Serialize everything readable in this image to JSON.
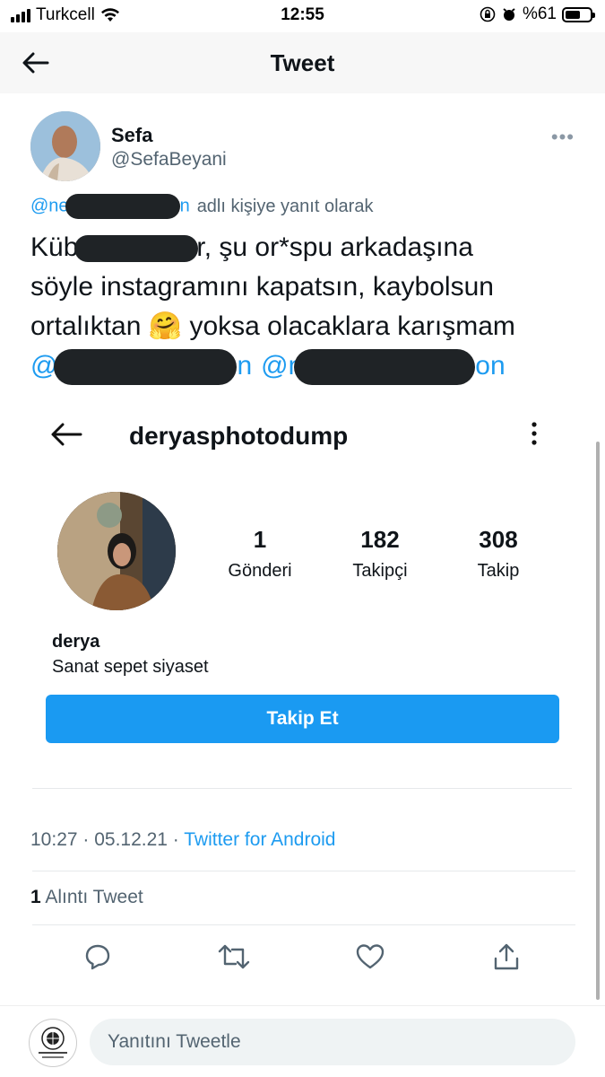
{
  "status_bar": {
    "carrier": "Turkcell",
    "time": "12:55",
    "battery": "%61",
    "battery_level": 0.61
  },
  "header": {
    "title": "Tweet"
  },
  "tweet": {
    "author_name": "Sefa",
    "author_handle": "@SefaBeyani",
    "reply_prefix": "@ne",
    "reply_suffix": "n",
    "reply_label": "adlı kişiye yanıt olarak",
    "text_start": "Küb",
    "text_after_redact": "r, şu or*spu arkadaşına",
    "text_line2": "söyle instagramını kapatsın, kaybolsun",
    "text_line3_a": "ortalıktan",
    "emoji": "🤗",
    "text_line3_b": "yoksa olacaklara karışmam",
    "mention1_prefix": "@",
    "mention1_suffix": "n",
    "mention2_prefix": "@n",
    "mention2_suffix": "on",
    "timestamp": "10:27 · 05.12.21 · ",
    "source": "Twitter for Android",
    "quote_count": "1",
    "quote_label": "Alıntı Tweet"
  },
  "instagram": {
    "username": "deryasphotodump",
    "stats": [
      {
        "num": "1",
        "label": "Gönderi"
      },
      {
        "num": "182",
        "label": "Takipçi"
      },
      {
        "num": "308",
        "label": "Takip"
      }
    ],
    "name": "derya",
    "bio": "Sanat sepet siyaset",
    "follow_label": "Takip Et"
  },
  "actions": [
    "reply-icon",
    "retweet-icon",
    "like-icon",
    "share-icon"
  ],
  "reply_bar": {
    "placeholder": "Yanıtını Tweetle"
  },
  "colors": {
    "accent": "#1d9bf0",
    "follow_button": "#1a9af2",
    "muted": "#536471"
  }
}
